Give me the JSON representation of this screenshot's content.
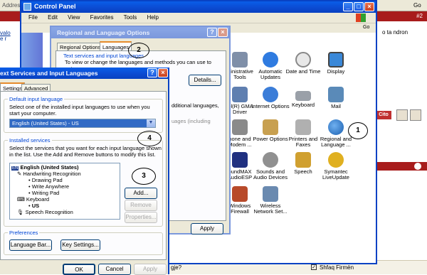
{
  "background": {
    "address_label": "Address",
    "go_label": "Go",
    "tab_number": "#2",
    "forum_text": "o ta ndron",
    "user_left_1": "valo",
    "user_left_2": "e r",
    "bottom_text": "gje?",
    "checkbox_label": "Shfaq Firmën",
    "cito_label": "Cito"
  },
  "control_panel": {
    "title": "Control Panel",
    "menu": [
      "File",
      "Edit",
      "View",
      "Favorites",
      "Tools",
      "Help"
    ],
    "go_label": "Go",
    "items": [
      {
        "label": "ministrative Tools",
        "icon": "admin-tools-icon",
        "color": "#7f8fa8"
      },
      {
        "label": "Automatic Updates",
        "icon": "automatic-updates-icon",
        "color": "#2f7be0"
      },
      {
        "label": "Date and Time",
        "icon": "clock-icon",
        "color": "#d9d9d9"
      },
      {
        "label": "Display",
        "icon": "display-icon",
        "color": "#3a88d8"
      },
      {
        "label": "tel(R) GMA Driver",
        "icon": "intel-gma-icon",
        "color": "#5f7fb0"
      },
      {
        "label": "Internet Options",
        "icon": "internet-options-icon",
        "color": "#3b7dd8"
      },
      {
        "label": "Keyboard",
        "icon": "keyboard-icon",
        "color": "#9aa0a8"
      },
      {
        "label": "Mail",
        "icon": "mail-icon",
        "color": "#5a8ab8"
      },
      {
        "label": "hone and Modem ...",
        "icon": "phone-modem-icon",
        "color": "#8a8a8a"
      },
      {
        "label": "Power Options",
        "icon": "power-options-icon",
        "color": "#c8a050"
      },
      {
        "label": "Printers and Faxes",
        "icon": "printer-icon",
        "color": "#b0b0b0"
      },
      {
        "label": "Regional and Language ...",
        "icon": "globe-icon",
        "color": "#3a7fc8"
      },
      {
        "label": "oundMAX AudioESP",
        "icon": "soundmax-icon",
        "color": "#203080"
      },
      {
        "label": "Sounds and Audio Devices",
        "icon": "speaker-icon",
        "color": "#909090"
      },
      {
        "label": "Speech",
        "icon": "speech-icon",
        "color": "#d0a030"
      },
      {
        "label": "Symantec LiveUpdate",
        "icon": "symantec-icon",
        "color": "#e0b020"
      },
      {
        "label": "Windows Firewall",
        "icon": "firewall-icon",
        "color": "#b84a2a"
      },
      {
        "label": "Wireless Network Set...",
        "icon": "wireless-icon",
        "color": "#6a8ab0"
      }
    ]
  },
  "regional_dialog": {
    "title": "Regional and Language Options",
    "tabs": [
      "Regional Options",
      "Languages"
    ],
    "group_label": "Text services and input languages",
    "group_text": "To view or change the languages and methods you can use to enter",
    "details_button": "Details...",
    "partial_1": "dditional languages,",
    "partial_2": "uages (including",
    "apply_button": "Apply"
  },
  "text_services_dialog": {
    "title": "ext Services and Input Languages",
    "tabs": [
      "Settings",
      "Advanced"
    ],
    "default_group": "Default input language",
    "default_desc": "Select one of the installed input languages to use when you start your computer.",
    "selected_language": "English (United States) - US",
    "installed_group": "Installed services",
    "installed_desc": "Select the services that you want for each input language shown in the list. Use the Add and Remove buttons to modify this list.",
    "tree": [
      {
        "text": "English (United States)",
        "level": 0,
        "badge": "EN"
      },
      {
        "text": "Handwriting Recognition",
        "level": 1
      },
      {
        "text": "Drawing Pad",
        "level": 2
      },
      {
        "text": "Write Anywhere",
        "level": 2
      },
      {
        "text": "Writing Pad",
        "level": 2
      },
      {
        "text": "Keyboard",
        "level": 1
      },
      {
        "text": "US",
        "level": 2
      },
      {
        "text": "Speech Recognition",
        "level": 1
      }
    ],
    "add_button": "Add...",
    "remove_button": "Remove",
    "properties_button": "Properties...",
    "preferences_group": "Preferences",
    "language_bar_button": "Language Bar...",
    "key_settings_button": "Key Settings...",
    "ok_button": "OK",
    "cancel_button": "Cancel",
    "apply_button": "Apply"
  },
  "annotations": [
    "1",
    "2",
    "3",
    "4"
  ]
}
